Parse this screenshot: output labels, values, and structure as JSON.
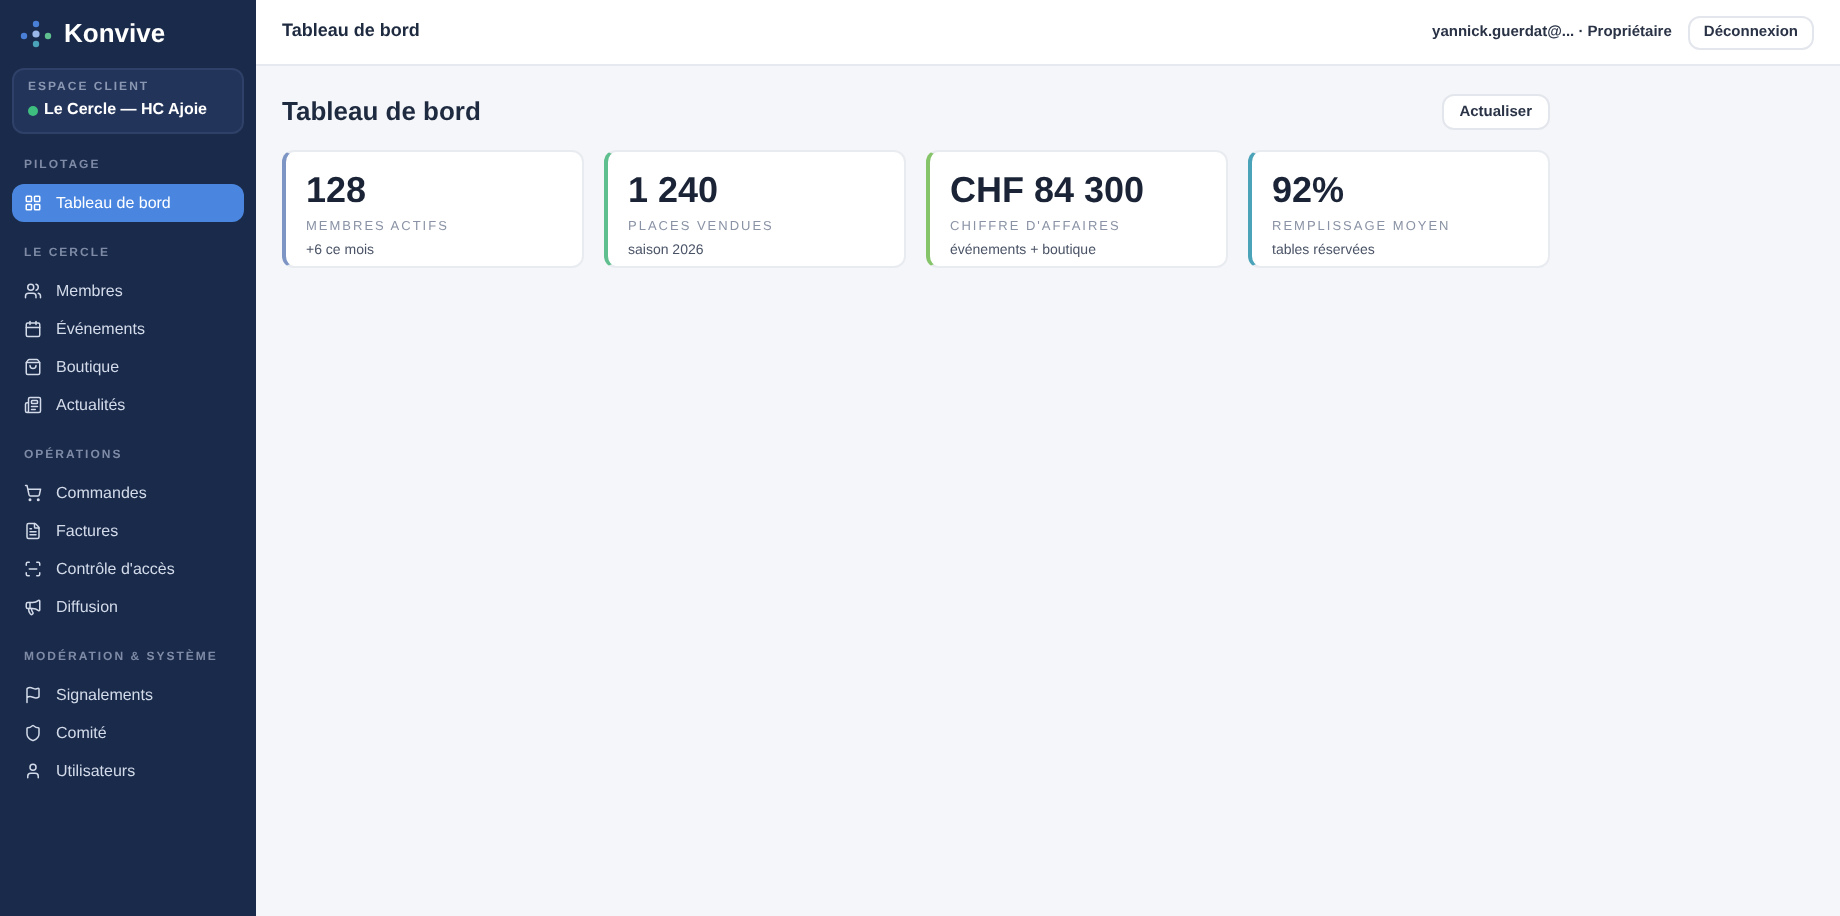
{
  "brand": "Konvive",
  "workspace": {
    "label": "ESPACE CLIENT",
    "name": "Le Cercle — HC Ajoie"
  },
  "sidebar": {
    "sections": [
      {
        "title": "PILOTAGE",
        "items": [
          {
            "label": "Tableau de bord",
            "selected": true
          }
        ]
      },
      {
        "title": "LE CERCLE",
        "items": [
          {
            "label": "Membres",
            "selected": false
          },
          {
            "label": "Événements",
            "selected": false
          },
          {
            "label": "Boutique",
            "selected": false
          },
          {
            "label": "Actualités",
            "selected": false
          }
        ]
      },
      {
        "title": "OPÉRATIONS",
        "items": [
          {
            "label": "Commandes",
            "selected": false
          },
          {
            "label": "Factures",
            "selected": false
          },
          {
            "label": "Contrôle d'accès",
            "selected": false
          },
          {
            "label": "Diffusion",
            "selected": false
          }
        ]
      },
      {
        "title": "MODÉRATION & SYSTÈME",
        "items": [
          {
            "label": "Signalements",
            "selected": false
          },
          {
            "label": "Comité",
            "selected": false
          },
          {
            "label": "Utilisateurs",
            "selected": false
          }
        ]
      }
    ]
  },
  "header": {
    "title": "Tableau de bord",
    "user": "yannick.guerdat@... · Propriétaire",
    "logout": "Déconnexion"
  },
  "page": {
    "title": "Tableau de bord",
    "refresh": "Actualiser"
  },
  "stats": [
    {
      "value": "128",
      "label": "MEMBRES ACTIFS",
      "note": "+6 ce mois",
      "color": "#7d95c4"
    },
    {
      "value": "1 240",
      "label": "PLACES VENDUES",
      "note": "saison 2026",
      "color": "#5fbf8f"
    },
    {
      "value": "CHF 84 300",
      "label": "CHIFFRE D'AFFAIRES",
      "note": "événements + boutique",
      "color": "#86c46a"
    },
    {
      "value": "92%",
      "label": "REMPLISSAGE MOYEN",
      "note": "tables réservées",
      "color": "#4aa3b8"
    }
  ]
}
